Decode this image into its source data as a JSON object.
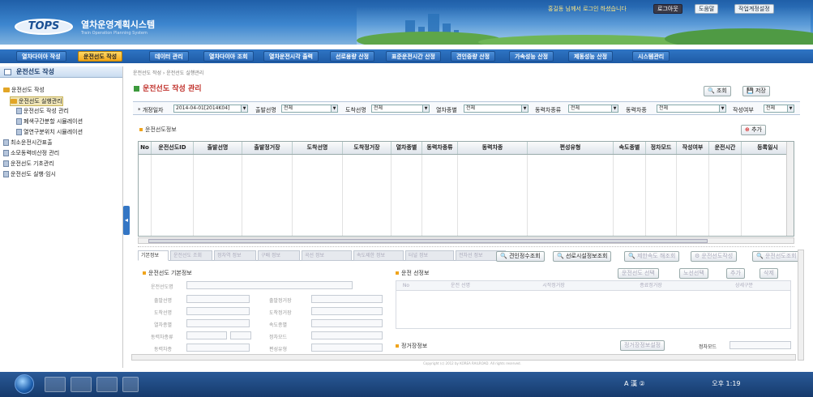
{
  "header": {
    "logo": "TOPS",
    "title": "열차운영계획시스템",
    "subtitle": "Train Operation Planning System",
    "user_text": "홍길동 님께서 로그인 하셨습니다",
    "buttons": [
      "로그아웃",
      "도움말",
      "작업계정설정"
    ]
  },
  "menu": {
    "items": [
      "열차다이아 작성",
      "운전선도 작성",
      "데이터 관리",
      "열차다이아 조회",
      "열차운전시각 출력",
      "선로용량 산정",
      "표준운전시간 산정",
      "견인중량 산정",
      "가속성능 산정",
      "제동성능 산정",
      "시스템관리"
    ],
    "active_index": 1
  },
  "sidebar": {
    "title": "운전선도 작성",
    "items": [
      "운전선도 작성",
      "운전선도 실행관리",
      "운전선도 작성 관리",
      "폐색구간분할 시뮬레이션",
      "열연구분위치 시뮬레이션",
      "최소운전시간표출",
      "소모동력비산정 관리",
      "운전선도 기초관리",
      "운전선도 실행·임시"
    ]
  },
  "main": {
    "breadcrumb": "운전선도 작성 › 운전선도 실행관리",
    "title": "운전선도 작성 관리",
    "search_label": "조회",
    "save_label": "저장",
    "filters": [
      {
        "label": "* 개정일자",
        "value": "2014-04-01[2014K04]"
      },
      {
        "label": "출발선명",
        "value": "전체"
      },
      {
        "label": "도착선명",
        "value": "전체"
      },
      {
        "label": "열차종별",
        "value": "전체"
      },
      {
        "label": "동력차종류",
        "value": "전체"
      },
      {
        "label": "동력차종",
        "value": "전체"
      },
      {
        "label": "작성여부",
        "value": "전체"
      }
    ],
    "section_info": "운전선도정보",
    "add_label": "추가",
    "grid_columns": [
      "No",
      "운전선도ID",
      "출발선명",
      "출발정거장",
      "도착선명",
      "도착정거장",
      "열차종별",
      "동력차종류",
      "동력차종",
      "편성유형",
      "속도종별",
      "정차모드",
      "작성여부",
      "운전시간",
      "등록일시"
    ],
    "tabs": [
      "기본정보",
      "운전선도 조회",
      "정차역 정보",
      "구배 정보",
      "곡선 정보",
      "속도제한 정보",
      "터널 정보",
      "전차선 정보"
    ],
    "action_buttons": [
      "견인정수조회",
      "선로시설정보조회",
      "제한속도 해조회",
      "운전선도작성",
      "운전선도조회"
    ],
    "basic_section": "운전선도 기본정보",
    "fields_left": [
      "운전선도명",
      "출발선명",
      "도착선명",
      "열차종별",
      "동력차종류",
      "동력차종"
    ],
    "fields_right": [
      "출발정거장",
      "도착정거장",
      "속도종별",
      "정차모드",
      "편성유형",
      "운전시간"
    ],
    "route_section": "운전 선정보",
    "route_columns": [
      "No",
      "운전 선명",
      "시작정거장",
      "종료정거장",
      "상세구분"
    ],
    "route_buttons": [
      "운전선도 선택",
      "노선선택",
      "추가",
      "삭제"
    ],
    "stop_section": "정거장정보",
    "stop_button": "정거장정보설정",
    "stop_mode_label": "정차모드",
    "footer": "Copyright (c) 2012 by KOREA RAILROAD. All rights reserved."
  },
  "taskbar": {
    "tray_text": "A 漢 ②",
    "clock": "오후 1:19"
  }
}
